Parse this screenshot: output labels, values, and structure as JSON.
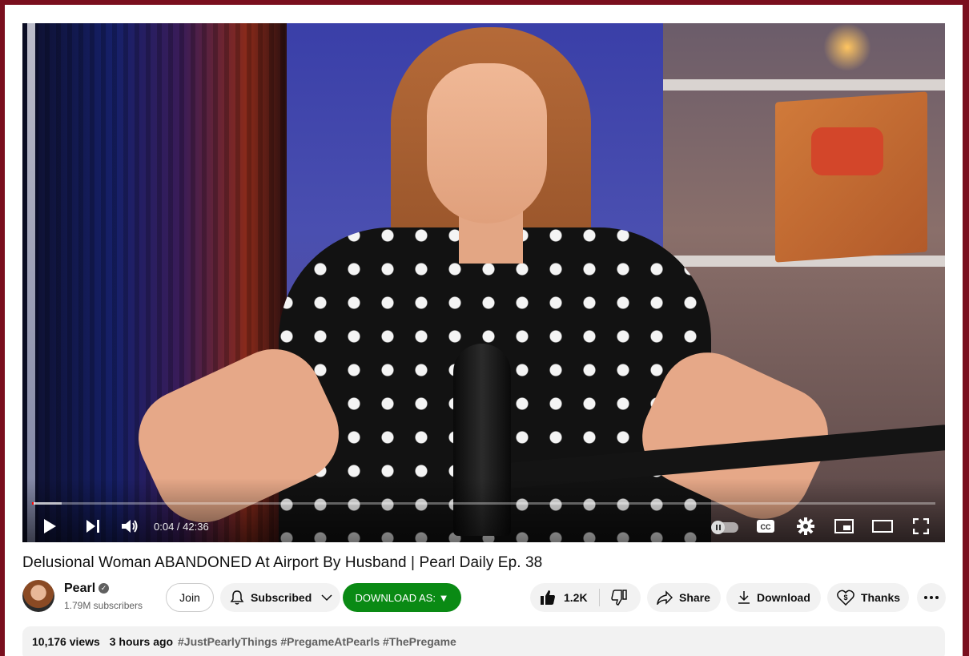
{
  "video": {
    "current_time": "0:04",
    "duration": "42:36",
    "time_display": "0:04 / 42:36",
    "progress_fraction": 0.0016,
    "buffer_fraction": 0.033
  },
  "title": "Delusional Woman ABANDONED At Airport By Husband | Pearl Daily Ep. 38",
  "channel": {
    "name": "Pearl",
    "subscribers": "1.79M subscribers",
    "verified": true
  },
  "actions": {
    "join": "Join",
    "subscribed": "Subscribed",
    "download_as": "DOWNLOAD AS: ▼",
    "like_count": "1.2K",
    "share": "Share",
    "download": "Download",
    "thanks": "Thanks"
  },
  "description": {
    "views": "10,176 views",
    "ago": "3 hours ago",
    "tags": "#JustPearlyThings #PregameAtPearls #ThePregame"
  },
  "colors": {
    "page_border": "#7a0f1e",
    "progress": "#ff0000",
    "download_as_bg": "#0a8a14"
  },
  "icons": {
    "play": "play-icon",
    "next": "next-icon",
    "volume": "volume-icon",
    "autoplay": "autoplay-toggle-icon",
    "captions": "cc-icon",
    "settings": "gear-icon",
    "miniplayer": "miniplayer-icon",
    "theater": "theater-icon",
    "fullscreen": "fullscreen-icon",
    "bell": "bell-icon",
    "like": "thumbs-up-icon",
    "dislike": "thumbs-down-icon",
    "share": "share-icon",
    "download": "download-icon",
    "thanks": "heart-dollar-icon",
    "more": "more-icon"
  }
}
